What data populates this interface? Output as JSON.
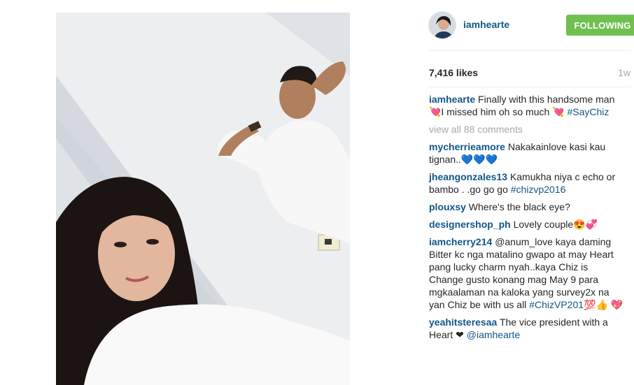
{
  "post": {
    "username": "iamhearte",
    "follow_label": "FOLLOWING",
    "likes": "7,416 likes",
    "age": "1w",
    "caption_user": "iamhearte",
    "caption_text": "Finally with this handsome man💘I missed him oh so much 💘",
    "caption_tag": "#SayChiz",
    "view_all": "view all 88 comments"
  },
  "comments": [
    {
      "user": "mycherrieamore",
      "text": "Nakakainlove kasi kau tignan..💙💙💙",
      "tail": ""
    },
    {
      "user": "jheangonzales13",
      "text": "Kamukha niya c echo or bambo . .go go go",
      "tail": "#chizvp2016"
    },
    {
      "user": "plouxsy",
      "text": "Where's the black eye?",
      "tail": ""
    },
    {
      "user": "designershop_ph",
      "text": "Lovely couple😍💞",
      "tail": ""
    },
    {
      "user": "iamcherry214",
      "text": "@anum_love kaya daming Bitter kc nga matalino gwapo at may Heart pang lucky charm nyah..kaya Chiz is Change gusto konang mag May 9 para mgkaalaman na kaloka yang survey2x na yan Chiz be with us all",
      "tail": "#ChizVP201💯👍 💖"
    },
    {
      "user": "yeahitsteresaa",
      "text": "The vice president with a Heart ❤",
      "tail": "@iamhearte"
    }
  ],
  "colors": {
    "link": "#125688",
    "follow_bg": "#70c050",
    "muted": "#a5a7aa"
  }
}
